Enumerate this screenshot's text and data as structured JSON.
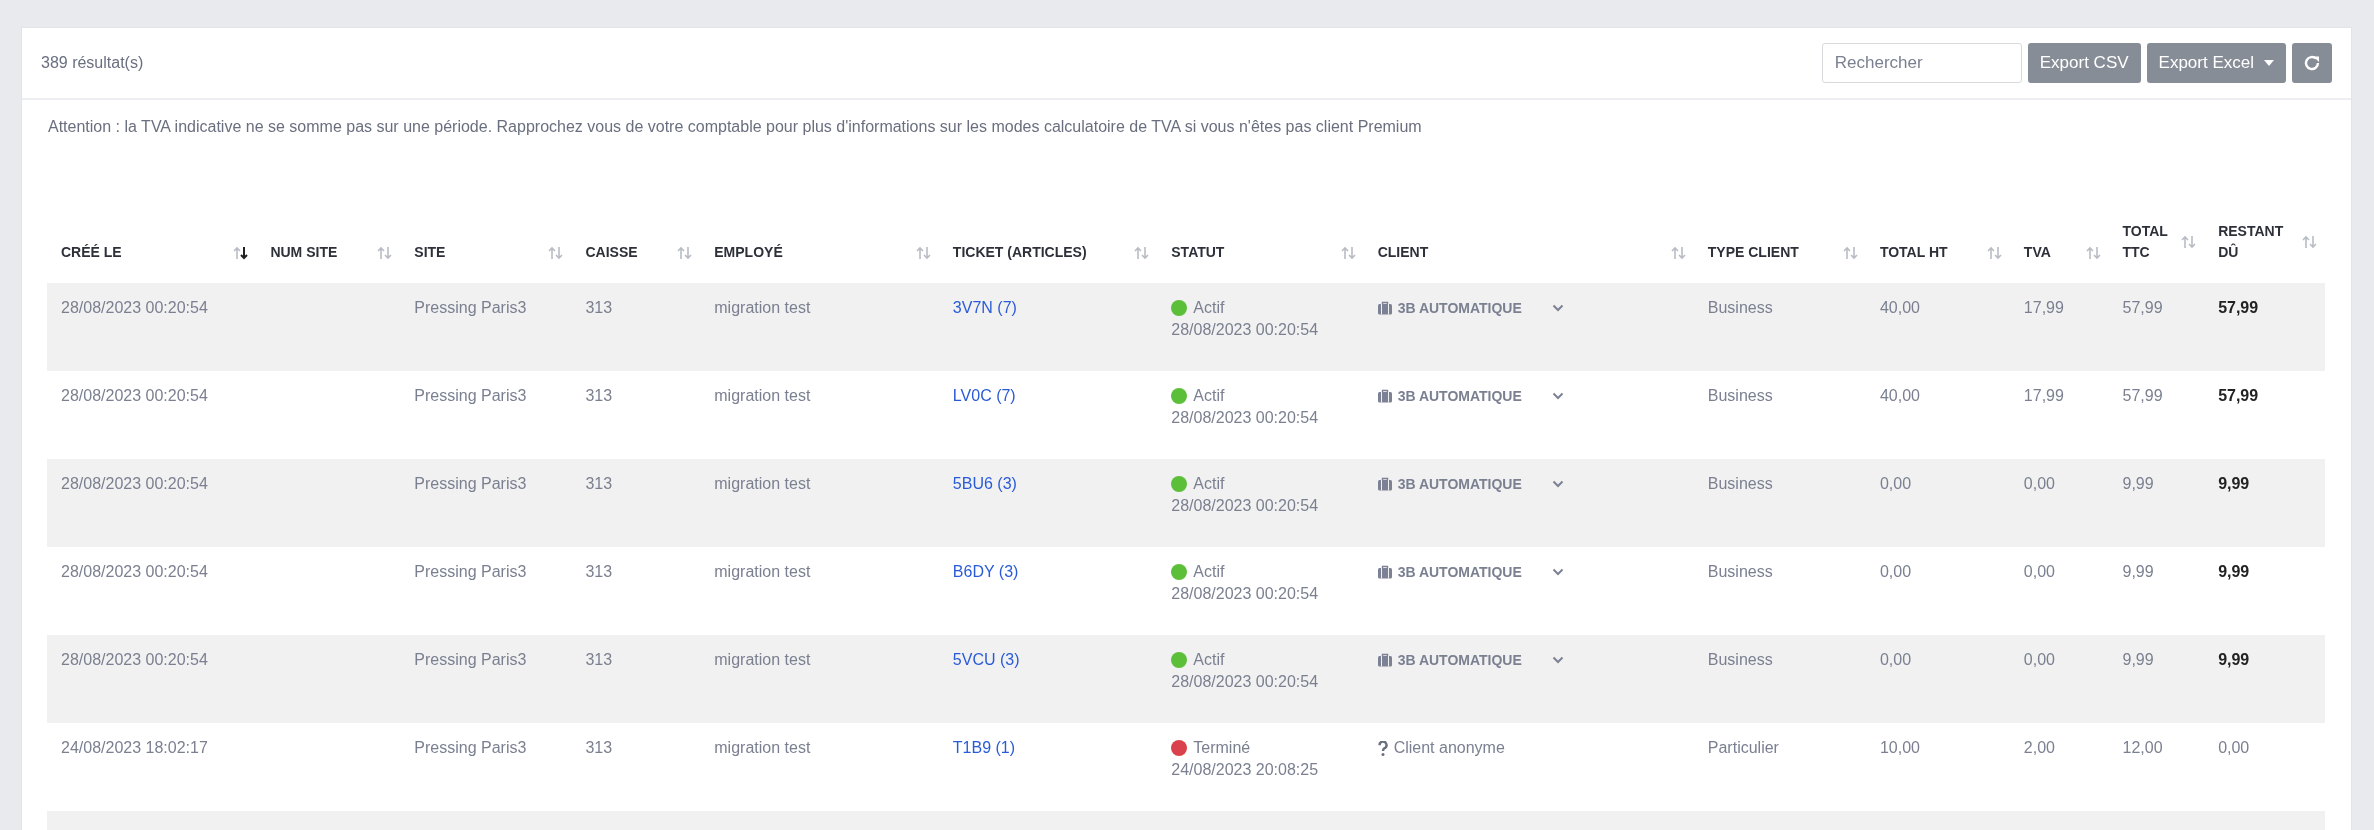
{
  "result_count": "389 résultat(s)",
  "toolbar": {
    "search": {
      "placeholder": "Rechercher"
    },
    "buttons": [
      {
        "label": "Export CSV",
        "kind": "plain"
      },
      {
        "label": "Export Excel",
        "kind": "dropdown"
      },
      {
        "kind": "refresh"
      }
    ]
  },
  "notice": "Attention : la TVA indicative ne se somme pas sur une période. Rapprochez vous de votre comptable pour plus d'informations sur les modes calculatoire de TVA si vous n'êtes pas client Premium",
  "table": {
    "columns": [
      {
        "label": "CRÉÉ LE",
        "sorted": true
      },
      {
        "label": "NUM SITE",
        "sorted": false
      },
      {
        "label": "SITE",
        "sorted": false
      },
      {
        "label": "CAISSE",
        "sorted": false
      },
      {
        "label": "EMPLOYÉ",
        "sorted": false
      },
      {
        "label": "TICKET (ARTICLES)",
        "sorted": false
      },
      {
        "label": "STATUT",
        "sorted": false
      },
      {
        "label": "CLIENT",
        "sorted": false
      },
      {
        "label": "TYPE CLIENT",
        "sorted": false
      },
      {
        "label": "TOTAL HT",
        "sorted": false
      },
      {
        "label": "TVA",
        "sorted": false
      },
      {
        "label": "TOTAL TTC",
        "sorted": false
      },
      {
        "label": "RESTANT DÛ",
        "sorted": false
      }
    ],
    "rows": [
      {
        "created": "28/08/2023 00:20:54",
        "site": "Pressing Paris3",
        "register": "313",
        "employee": "migration test",
        "ticket": "3V7N (7)",
        "status": {
          "label": "Actif",
          "color": "#5cbf3a",
          "date": "28/08/2023 00:20:54"
        },
        "client": {
          "kind": "business",
          "name": "3B AUTOMATIQUE"
        },
        "client_type": "Business",
        "total_ht": "40,00",
        "tva": "17,99",
        "total_ttc": "57,99",
        "remaining": "57,99",
        "remaining_due": true
      },
      {
        "created": "28/08/2023 00:20:54",
        "site": "Pressing Paris3",
        "register": "313",
        "employee": "migration test",
        "ticket": "LV0C (7)",
        "status": {
          "label": "Actif",
          "color": "#5cbf3a",
          "date": "28/08/2023 00:20:54"
        },
        "client": {
          "kind": "business",
          "name": "3B AUTOMATIQUE"
        },
        "client_type": "Business",
        "total_ht": "40,00",
        "tva": "17,99",
        "total_ttc": "57,99",
        "remaining": "57,99",
        "remaining_due": true
      },
      {
        "created": "28/08/2023 00:20:54",
        "site": "Pressing Paris3",
        "register": "313",
        "employee": "migration test",
        "ticket": "5BU6 (3)",
        "status": {
          "label": "Actif",
          "color": "#5cbf3a",
          "date": "28/08/2023 00:20:54"
        },
        "client": {
          "kind": "business",
          "name": "3B AUTOMATIQUE"
        },
        "client_type": "Business",
        "total_ht": "0,00",
        "tva": "0,00",
        "total_ttc": "9,99",
        "remaining": "9,99",
        "remaining_due": true
      },
      {
        "created": "28/08/2023 00:20:54",
        "site": "Pressing Paris3",
        "register": "313",
        "employee": "migration test",
        "ticket": "B6DY (3)",
        "status": {
          "label": "Actif",
          "color": "#5cbf3a",
          "date": "28/08/2023 00:20:54"
        },
        "client": {
          "kind": "business",
          "name": "3B AUTOMATIQUE"
        },
        "client_type": "Business",
        "total_ht": "0,00",
        "tva": "0,00",
        "total_ttc": "9,99",
        "remaining": "9,99",
        "remaining_due": true
      },
      {
        "created": "28/08/2023 00:20:54",
        "site": "Pressing Paris3",
        "register": "313",
        "employee": "migration test",
        "ticket": "5VCU (3)",
        "status": {
          "label": "Actif",
          "color": "#5cbf3a",
          "date": "28/08/2023 00:20:54"
        },
        "client": {
          "kind": "business",
          "name": "3B AUTOMATIQUE"
        },
        "client_type": "Business",
        "total_ht": "0,00",
        "tva": "0,00",
        "total_ttc": "9,99",
        "remaining": "9,99",
        "remaining_due": true
      },
      {
        "created": "24/08/2023 18:02:17",
        "site": "Pressing Paris3",
        "register": "313",
        "employee": "migration test",
        "ticket": "T1B9 (1)",
        "status": {
          "label": "Terminé",
          "color": "#d9424c",
          "date": "24/08/2023 20:08:25"
        },
        "client": {
          "kind": "anonymous",
          "name": "Client anonyme"
        },
        "client_type": "Particulier",
        "total_ht": "10,00",
        "tva": "2,00",
        "total_ttc": "12,00",
        "remaining": "0,00",
        "remaining_due": false
      }
    ]
  }
}
